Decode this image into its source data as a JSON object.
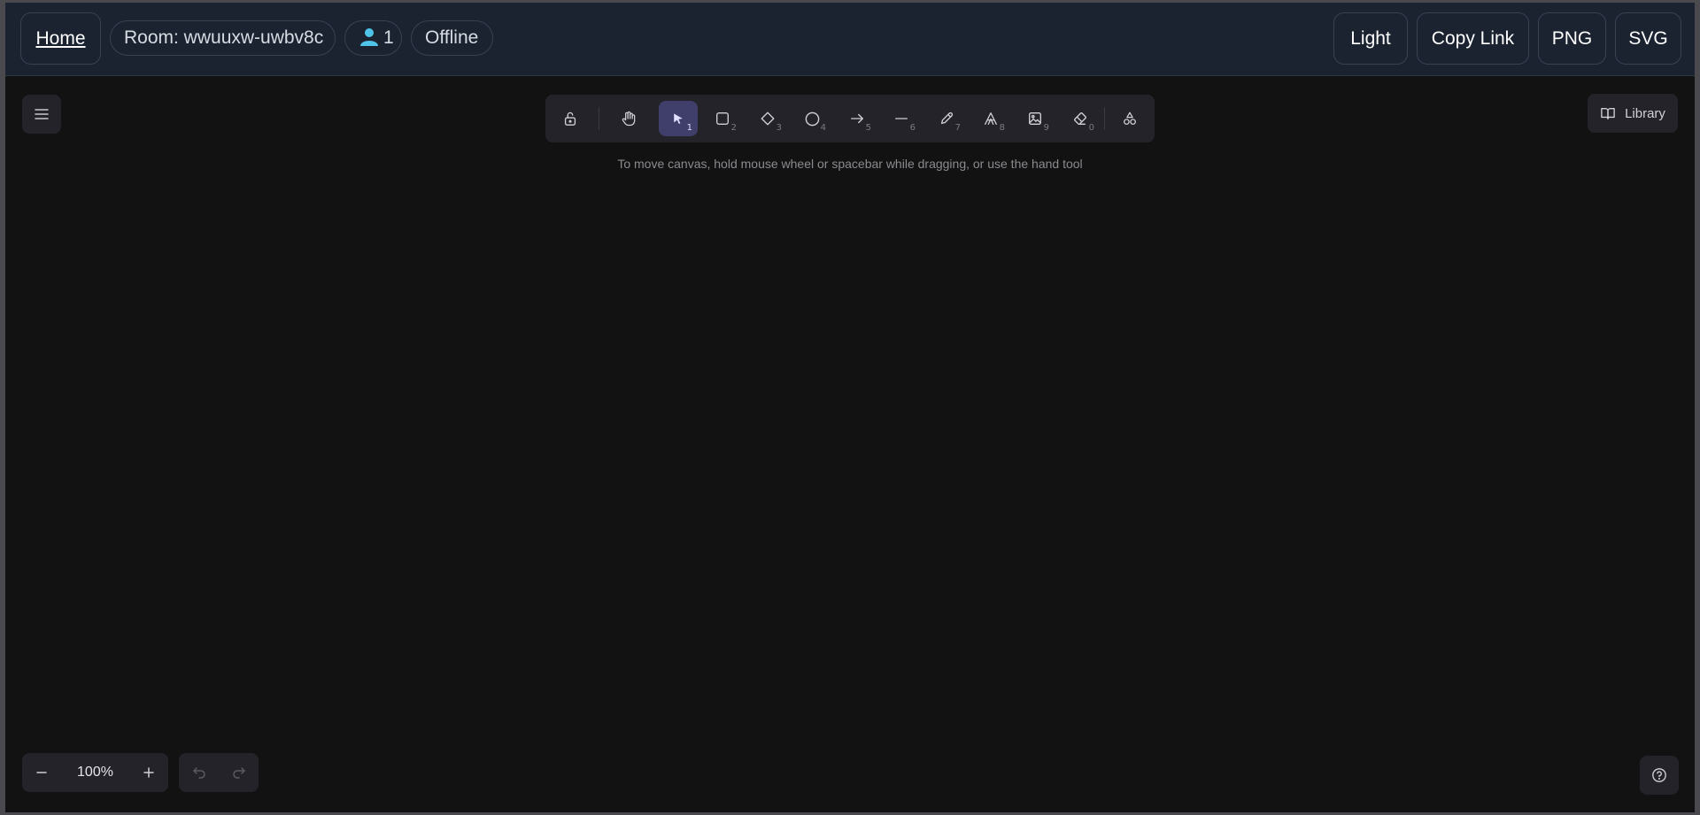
{
  "header": {
    "home_label": "Home",
    "room_label": "Room: wwuuxw-uwbv8c",
    "users_count": "1",
    "status_label": "Offline",
    "theme_label": "Light",
    "copy_link_label": "Copy Link",
    "png_label": "PNG",
    "svg_label": "SVG"
  },
  "toolbar": {
    "tools": [
      {
        "name": "lock",
        "icon": "lock-icon",
        "key": ""
      },
      {
        "name": "hand",
        "icon": "hand-icon",
        "key": ""
      },
      {
        "name": "selection",
        "icon": "pointer-icon",
        "key": "1",
        "active": true
      },
      {
        "name": "rectangle",
        "icon": "square-icon",
        "key": "2"
      },
      {
        "name": "diamond",
        "icon": "diamond-icon",
        "key": "3"
      },
      {
        "name": "ellipse",
        "icon": "circle-icon",
        "key": "4"
      },
      {
        "name": "arrow",
        "icon": "arrow-right-icon",
        "key": "5"
      },
      {
        "name": "line",
        "icon": "line-icon",
        "key": "6"
      },
      {
        "name": "draw",
        "icon": "pencil-icon",
        "key": "7"
      },
      {
        "name": "text",
        "icon": "text-icon",
        "key": "8"
      },
      {
        "name": "image",
        "icon": "image-icon",
        "key": "9"
      },
      {
        "name": "eraser",
        "icon": "eraser-icon",
        "key": "0"
      },
      {
        "name": "shapes",
        "icon": "shapes-icon",
        "key": ""
      }
    ],
    "hint": "To move canvas, hold mouse wheel or spacebar while dragging, or use the hand tool"
  },
  "library": {
    "label": "Library"
  },
  "zoom": {
    "value": "100%"
  },
  "colors": {
    "header_bg": "#1b2331",
    "canvas_bg": "#121212",
    "panel_bg": "#232329",
    "active_tool_bg": "#403e6a",
    "user_avatar": "#4fc3e8"
  }
}
